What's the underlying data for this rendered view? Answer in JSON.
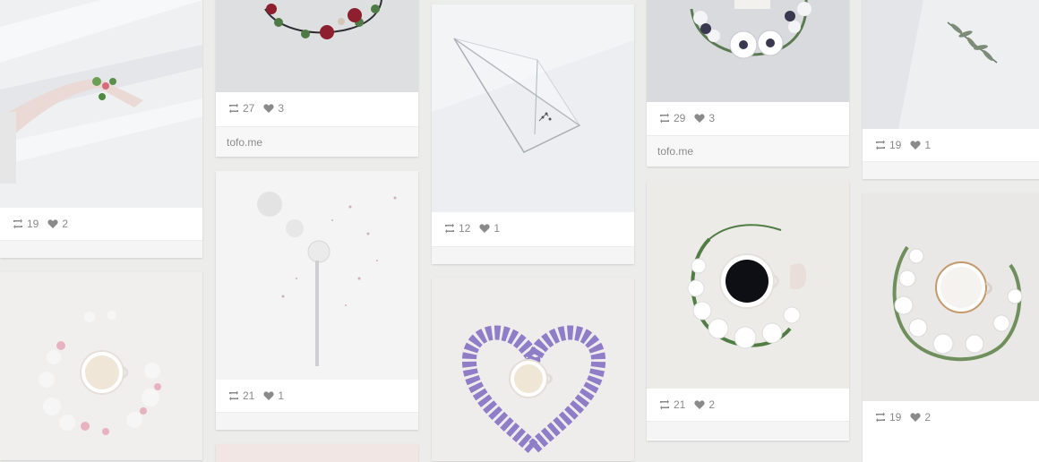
{
  "colors": {
    "background": "#ececeb",
    "meta_text": "#8a8a8a",
    "card": "#ffffff"
  },
  "icons": {
    "repost": "repost-icon",
    "like": "heart-icon"
  },
  "cards": [
    {
      "reposts": "19",
      "likes": "2"
    },
    {
      "reposts": "27",
      "likes": "3",
      "source": "tofo.me"
    },
    {
      "reposts": "12",
      "likes": "1"
    },
    {
      "reposts": "29",
      "likes": "3",
      "source": "tofo.me"
    },
    {
      "reposts": "19",
      "likes": "1"
    },
    {
      "reposts": "21",
      "likes": "1"
    },
    {
      "reposts": "21",
      "likes": "2"
    },
    {
      "reposts": "19",
      "likes": "2"
    }
  ]
}
